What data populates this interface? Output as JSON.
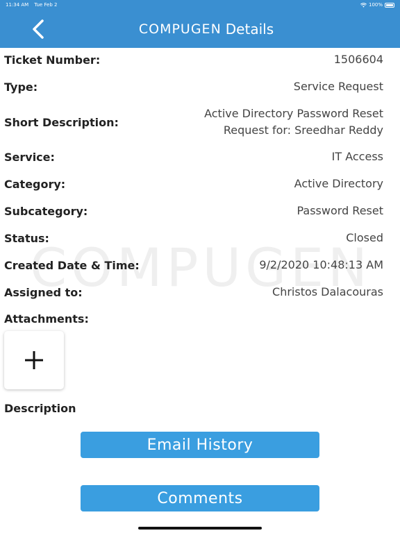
{
  "status_bar": {
    "time": "11:34 AM",
    "date": "Tue Feb 2",
    "battery": "100%"
  },
  "navbar": {
    "logo": "COMPUGEN",
    "title": "Details",
    "back_icon": "chevron-left-icon"
  },
  "watermark": "COMPUGEN",
  "fields": [
    {
      "label": "Ticket Number:",
      "value": "1506604"
    },
    {
      "label": "Type:",
      "value": "Service Request"
    },
    {
      "label": "Short Description:",
      "value": "Active Directory Password Reset",
      "value2": "Request for: Sreedhar Reddy"
    },
    {
      "label": "Service:",
      "value": "IT Access"
    },
    {
      "label": "Category:",
      "value": "Active Directory"
    },
    {
      "label": "Subcategory:",
      "value": "Password Reset"
    },
    {
      "label": "Status:",
      "value": "Closed"
    },
    {
      "label": "Created Date & Time:",
      "value": "9/2/2020 10:48:13 AM"
    },
    {
      "label": "Assigned to:",
      "value": "Christos Dalacouras"
    }
  ],
  "attachments": {
    "label": "Attachments:",
    "add_icon": "plus-icon"
  },
  "description_label": "Description",
  "buttons": {
    "email_history": "Email History",
    "comments": "Comments"
  },
  "colors": {
    "header_blue": "#3a8fd1",
    "button_blue": "#3a9ee0"
  }
}
